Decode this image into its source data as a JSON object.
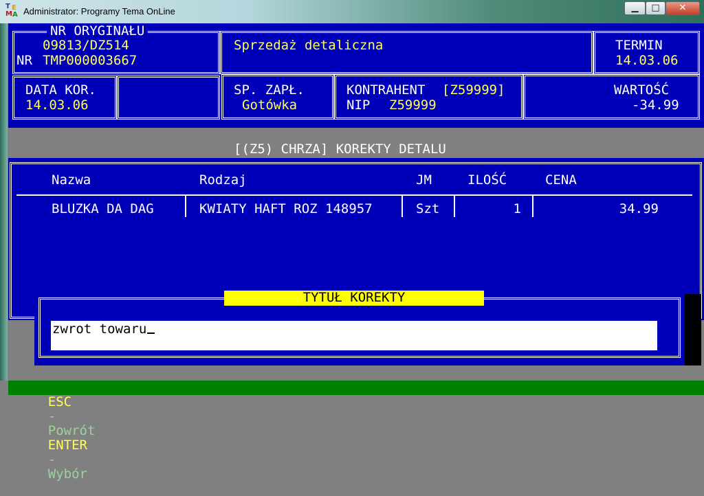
{
  "window": {
    "title": "Administrator: Programy Tema OnLine",
    "icon_letters": [
      "T",
      "E",
      "M",
      "A"
    ],
    "minimize_symbol": "▁",
    "maximize_symbol": "□",
    "close_symbol": "✕"
  },
  "header": {
    "nr_original_label": "NR ORYGINAŁU",
    "nr_original_value": "09813/DZ514",
    "nr_label": "NR",
    "nr_value": "TMP000003667",
    "document_type": "Sprzedaż detaliczna",
    "termin_label": "TERMIN",
    "termin_value": "14.03.06",
    "data_kor_label": "DATA KOR.",
    "data_kor_value": "14.03.06",
    "payment_label": "SP. ZAPŁ.",
    "payment_value": "Gotówka",
    "contractor_label": "KONTRAHENT",
    "contractor_code": "[Z59999]",
    "nip_label": "NIP",
    "nip_value": "Z59999",
    "value_label": "WARTOŚĆ",
    "value_amount": "-34.99"
  },
  "section_title": "[(Z5) CHRZA] KOREKTY DETALU",
  "table": {
    "headers": [
      "Nazwa",
      "Rodzaj",
      "JM",
      "ILOŚĆ",
      "CENA"
    ],
    "rows": [
      {
        "nazwa": "BLUZKA DA DAG",
        "rodzaj": "KWIATY HAFT ROZ 148957",
        "jm": "Szt",
        "ilosc": "1",
        "cena": "34.99"
      }
    ]
  },
  "dialog": {
    "title": "TYTUŁ KOREKTY",
    "input_value": "zwrot towaru"
  },
  "statusbar": {
    "esc_key": "ESC",
    "esc_action": "Powrót",
    "enter_key": "ENTER",
    "enter_action": "Wybór",
    "separator": "-"
  },
  "colors": {
    "console_blue": "#0000b8",
    "text_yellow": "#ffff55",
    "dialog_title_bg": "#ffff00",
    "statusbar_green": "#008000"
  }
}
